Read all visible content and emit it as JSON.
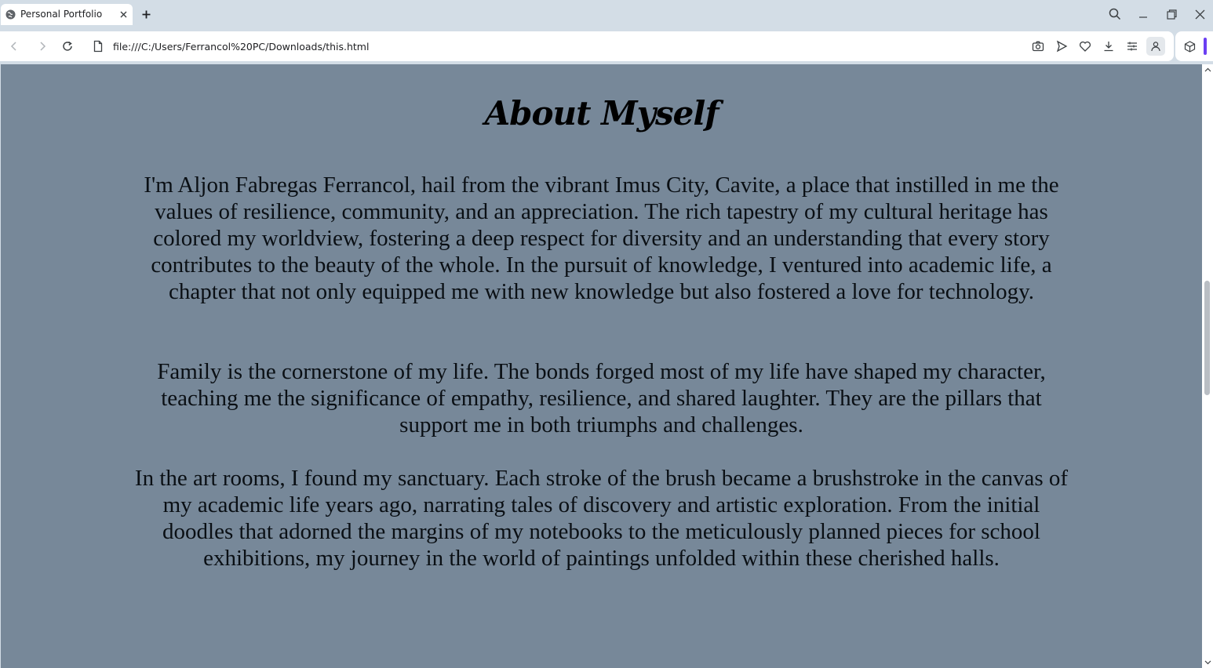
{
  "browser": {
    "tab": {
      "title": "Personal Portfolio",
      "favicon": "globe-icon"
    },
    "address_bar": {
      "url": "file:///C:/Users/Ferrancol%20PC/Downloads/this.html"
    },
    "icons": {
      "back": "arrow-left-icon",
      "forward": "arrow-right-icon",
      "reload": "reload-icon",
      "page": "file-icon",
      "screenshot": "camera-icon",
      "send": "send-icon",
      "favorite": "heart-icon",
      "download": "download-icon",
      "menu": "menu-icon",
      "profile": "profile-icon",
      "extensions": "cube-icon"
    },
    "accent_color": "#6b3ff2"
  },
  "page": {
    "background_color": "#778899",
    "heading": "About Myself",
    "paragraphs": [
      "I'm Aljon Fabregas Ferrancol, hail from the vibrant Imus City, Cavite, a place that instilled in me the values of resilience, community, and an appreciation. The rich tapestry of my cultural heritage has colored my worldview, fostering a deep respect for diversity and an understanding that every story contributes to the beauty of the whole. In the pursuit of knowledge, I ventured into academic life, a chapter that not only equipped me with new knowledge but also fostered a love for technology.",
      "Family is the cornerstone of my life. The bonds forged most of my life have shaped my character, teaching me the significance of empathy, resilience, and shared laughter. They are the pillars that support me in both triumphs and challenges.",
      "In the art rooms, I found my sanctuary. Each stroke of the brush became a brushstroke in the canvas of my academic life years ago, narrating tales of discovery and artistic exploration. From the initial doodles that adorned the margins of my notebooks to the meticulously planned pieces for school exhibitions, my journey in the world of paintings unfolded within these cherished halls."
    ]
  }
}
